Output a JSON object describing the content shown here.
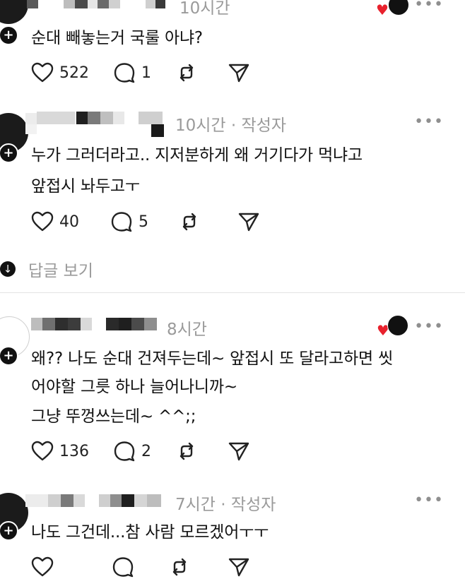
{
  "colors": {
    "meta": "#9a9a9a",
    "heart": "#e8212d",
    "text": "#111111"
  },
  "icons": {
    "like": "heart-outline-icon",
    "reply": "speech-bubble-icon",
    "repost": "repost-arrows-icon",
    "share": "paper-plane-icon",
    "more": "ellipsis-icon",
    "follow": "plus-icon",
    "expand": "chevron-down-icon"
  },
  "posts": [
    {
      "time": "10시간",
      "author_tag": "",
      "lines": [
        "순대 빼놓는거 국룰 아냐?"
      ],
      "likes": "522",
      "replies": "1",
      "liked_by_author": true
    },
    {
      "time": "10시간",
      "author_tag": "· 작성자",
      "lines": [
        "누가 그러더라고.. 지저분하게 왜 거기다가 먹냐고",
        "앞접시 놔두고ㅜ"
      ],
      "likes": "40",
      "replies": "5",
      "liked_by_author": false
    },
    {
      "time": "8시간",
      "author_tag": "",
      "lines": [
        "왜?? 나도 순대 건져두는데~ 앞접시 또 달라고하면 씻",
        "어야할 그릇 하나 늘어나니까~",
        "그냥 뚜껑쓰는데~ ^^;;"
      ],
      "likes": "136",
      "replies": "2",
      "liked_by_author": true
    },
    {
      "time": "7시간",
      "author_tag": "· 작성자",
      "lines": [
        "나도 그건데...참 사람 모르겠어ㅜㅜ"
      ],
      "likes": "",
      "replies": "",
      "liked_by_author": false
    }
  ],
  "more_label": "•••",
  "view_replies_label": "답글 보기"
}
